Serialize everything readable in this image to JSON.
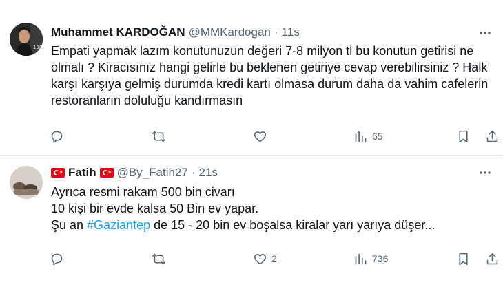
{
  "tweets": [
    {
      "name": "Muhammet KARDOĞAN",
      "handle": "@MMKardogan",
      "separator": "·",
      "time": "11s",
      "text": "Empati yapmak lazım konutunuzun değeri 7-8 milyon tl bu konutun getirisi ne olmalı ? Kiracısınız hangi gelirle bu beklenen getiriye cevap verebilirsiniz ? Halk karşı karşıya gelmiş durumda kredi kartı olmasa durum daha da vahim cafelerin restoranların doluluğu kandırmasın",
      "avatar_badge": "1983",
      "replies": "",
      "retweets": "",
      "likes": "",
      "views": "65"
    },
    {
      "name": "Fatih",
      "handle": "@By_Fatih27",
      "separator": "·",
      "time": "21s",
      "line1": "Ayrıca resmi rakam 500 bin civarı",
      "line2": "10 kişi bir evde kalsa 50 Bin ev yapar.",
      "line3_pre": "Şu an ",
      "line3_hashtag": "#Gaziantep",
      "line3_post": " de 15 - 20 bin ev boşalsa kiralar yarı yarıya düşer...",
      "replies": "",
      "retweets": "",
      "likes": "2",
      "views": "736"
    }
  ],
  "colors": {
    "text": "#0f1419",
    "secondary": "#536471",
    "link": "#1d9bf0",
    "divider": "#e5e8eb",
    "flag_red": "#e30a17"
  },
  "icons": [
    "more-icon",
    "reply-icon",
    "retweet-icon",
    "like-icon",
    "views-icon",
    "bookmark-icon",
    "share-icon",
    "turkish-flag-icon"
  ]
}
